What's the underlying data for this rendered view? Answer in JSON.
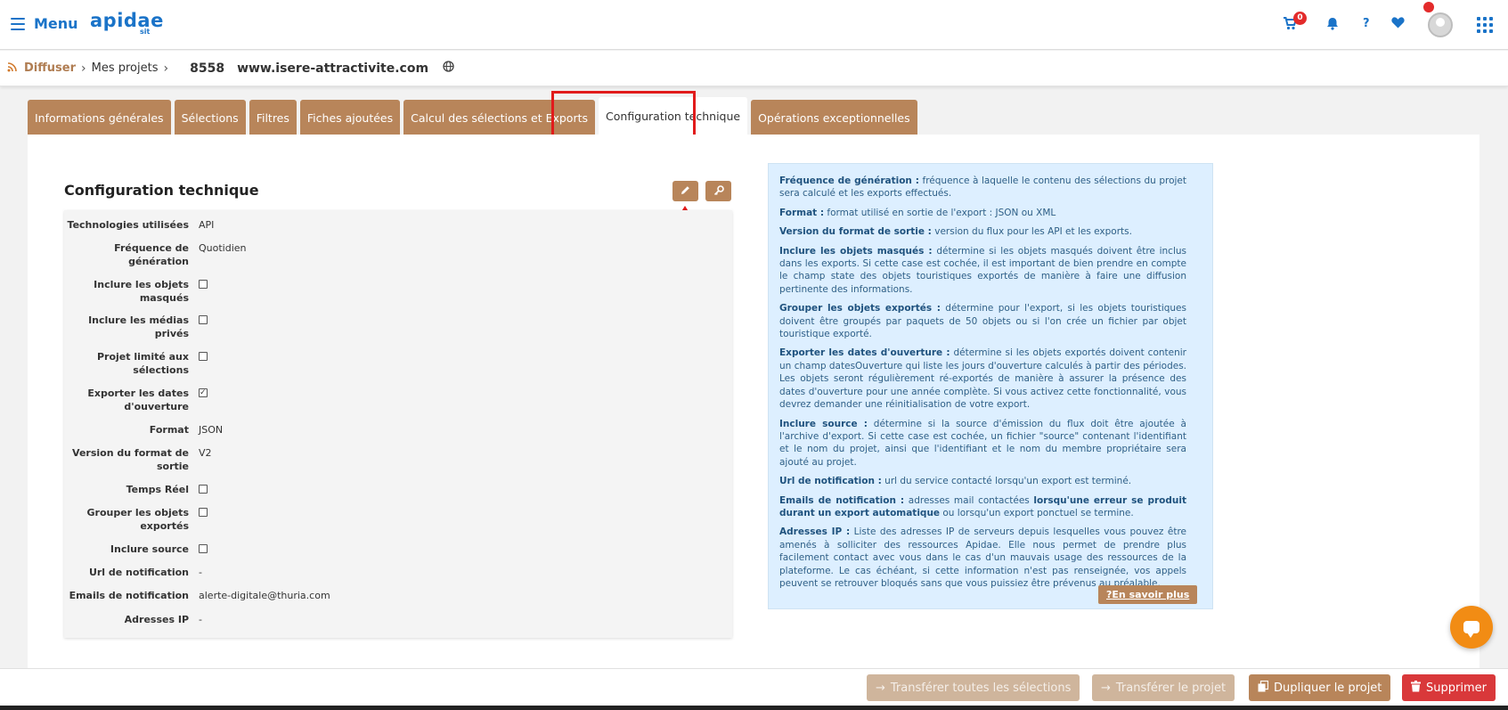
{
  "header": {
    "menu_label": "Menu",
    "logo_text": "apidae",
    "logo_sub": "sit",
    "cart_count": "0",
    "help_label": "?",
    "icons": [
      "cart-icon",
      "bell-icon",
      "help-icon",
      "heart-icon",
      "avatar",
      "apps-grid-icon"
    ]
  },
  "breadcrumb": {
    "root": "Diffuser",
    "parent": "Mes projets",
    "project_id": "8558",
    "project_site": "www.isere-attractivite.com"
  },
  "tabs": [
    {
      "label": "Informations générales",
      "active": false
    },
    {
      "label": "Sélections",
      "active": false
    },
    {
      "label": "Filtres",
      "active": false
    },
    {
      "label": "Fiches ajoutées",
      "active": false
    },
    {
      "label": "Calcul des sélections et Exports",
      "active": false
    },
    {
      "label": "Configuration technique",
      "active": true
    },
    {
      "label": "Opérations exceptionnelles",
      "active": false
    }
  ],
  "section": {
    "title": "Configuration technique",
    "edit_icon": "pencil-icon",
    "key_icon": "key-icon"
  },
  "config": [
    {
      "label": "Technologies utilisées",
      "value": "API"
    },
    {
      "label": "Fréquence de génération",
      "value": "Quotidien"
    },
    {
      "label": "Inclure les objets masqués",
      "checked": false
    },
    {
      "label": "Inclure les médias privés",
      "checked": false
    },
    {
      "label": "Projet limité aux sélections",
      "checked": false
    },
    {
      "label": "Exporter les dates d'ouverture",
      "checked": true
    },
    {
      "label": "Format",
      "value": "JSON"
    },
    {
      "label": "Version du format de sortie",
      "value": "V2"
    },
    {
      "label": "Temps Réel",
      "checked": false
    },
    {
      "label": "Grouper les objets exportés",
      "checked": false
    },
    {
      "label": "Inclure source",
      "checked": false
    },
    {
      "label": "Url de notification",
      "value": "-"
    },
    {
      "label": "Emails de notification",
      "value": "alerte-digitale@thuria.com"
    },
    {
      "label": "Adresses IP",
      "value": "-"
    }
  ],
  "help": {
    "items": [
      {
        "term": "Fréquence de génération :",
        "text": " fréquence à laquelle le contenu des sélections du projet sera calculé et les exports effectués."
      },
      {
        "term": "Format :",
        "text": " format utilisé en sortie de l'export : JSON ou XML"
      },
      {
        "term": "Version du format de sortie :",
        "text": " version du flux pour les API et les exports."
      },
      {
        "term": "Inclure les objets masqués :",
        "text": " détermine si les objets masqués doivent être inclus dans les exports. Si cette case est cochée, il est important de bien prendre en compte le champ state des objets touristiques exportés de manière à faire une diffusion pertinente des informations."
      },
      {
        "term": "Grouper les objets exportés :",
        "text": " détermine pour l'export, si les objets touristiques doivent être groupés par paquets de 50 objets ou si l'on crée un fichier par objet touristique exporté."
      },
      {
        "term": "Exporter les dates d'ouverture :",
        "text": " détermine si les objets exportés doivent contenir un champ datesOuverture qui liste les jours d'ouverture calculés à partir des périodes. Les objets seront régulièrement ré-exportés de manière à assurer la présence des dates d'ouverture pour une année complète. Si vous activez cette fonctionnalité, vous devrez demander une réinitialisation de votre export."
      },
      {
        "term": "Inclure source :",
        "text": " détermine si la source d'émission du flux doit être ajoutée à l'archive d'export. Si cette case est cochée, un fichier \"source\" contenant l'identifiant et le nom du projet, ainsi que l'identifiant et le nom du membre propriétaire sera ajouté au projet."
      },
      {
        "term": "Url de notification :",
        "text": " url du service contacté lorsqu'un export est terminé."
      },
      {
        "term": "Adresses IP :",
        "text": " Liste des adresses IP de serveurs depuis lesquelles vous pouvez être amenés à solliciter des ressources Apidae. Elle nous permet de prendre plus facilement contact avec vous dans le cas d'un mauvais usage des ressources de la plateforme. Le cas échéant, si cette information n'est pas renseignée, vos appels peuvent se retrouver bloqués sans que vous puissiez être prévenus au préalable."
      }
    ],
    "emails": {
      "term": "Emails de notification :",
      "text1": " adresses mail contactées ",
      "bold": "lorsqu'une erreur se produit durant un export automatique",
      "text2": " ou lorsqu'un export ponctuel se termine."
    },
    "learn_more": "En savoir plus"
  },
  "footer": {
    "transfer_selections": "Transférer toutes les sélections",
    "transfer_project": "Transférer le projet",
    "duplicate_project": "Dupliquer le projet",
    "delete": "Supprimer"
  },
  "colors": {
    "brand_blue": "#1a73c8",
    "tab_brown": "#b8855a",
    "highlight_red": "#e11b1b",
    "info_bg": "#ddefff",
    "danger": "#d9383a",
    "chat_orange": "#f28c14"
  }
}
